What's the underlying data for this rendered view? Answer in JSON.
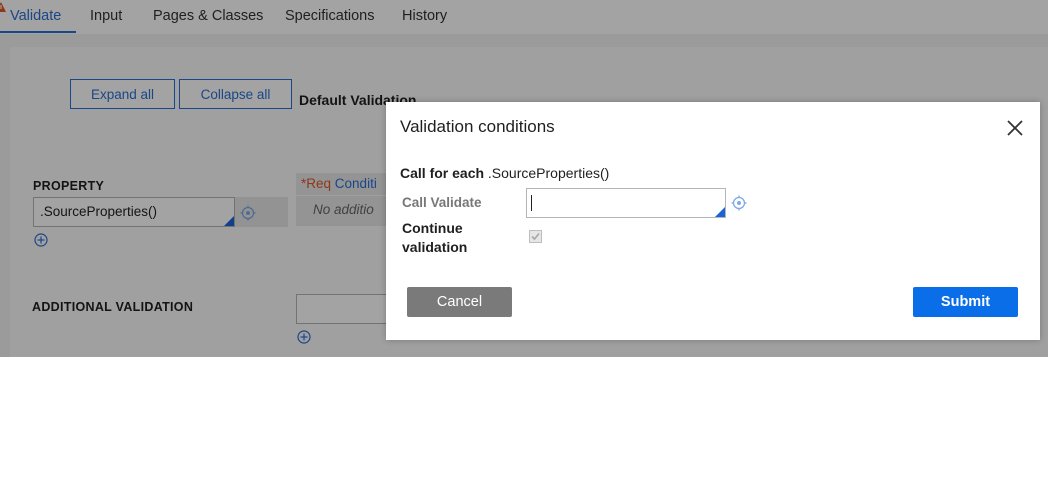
{
  "tabs": [
    {
      "label": "Validate",
      "active": true
    },
    {
      "label": "Input"
    },
    {
      "label": "Pages & Classes"
    },
    {
      "label": "Specifications"
    },
    {
      "label": "History"
    }
  ],
  "background": {
    "expand_all": "Expand all",
    "collapse_all": "Collapse all",
    "default_validation": "Default Validation",
    "property_label": "PROPERTY",
    "property_value": ".SourceProperties()",
    "req_marker": "*Req",
    "conditions_header": "Conditi",
    "no_additional": "No additio",
    "additional_validation_label": "ADDITIONAL VALIDATION"
  },
  "modal": {
    "title": "Validation conditions",
    "call_for_each_bold": "Call for each",
    "call_for_each_value": ".SourceProperties()",
    "call_validate_label": "Call Validate",
    "call_validate_value": "",
    "continue_label_line1": "Continue",
    "continue_label_line2": "validation",
    "continue_checked": true,
    "cancel_label": "Cancel",
    "submit_label": "Submit"
  },
  "colors": {
    "accent": "#2a6fd4",
    "submit": "#0a6ee8",
    "cancel": "#7a7a7a",
    "warning": "#e0562a"
  },
  "icons": [
    "warning-icon",
    "close-icon",
    "add-icon",
    "target-icon",
    "dropdown-corner-icon"
  ]
}
